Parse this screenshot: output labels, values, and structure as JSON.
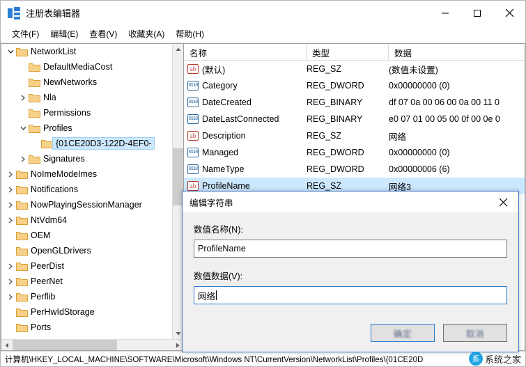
{
  "window": {
    "title": "注册表编辑器",
    "icon": "registry-icon",
    "minimize_label": "—",
    "maximize_label": "□",
    "close_label": "✕"
  },
  "menubar": {
    "items": [
      {
        "label": "文件(F)",
        "name": "menu-file"
      },
      {
        "label": "编辑(E)",
        "name": "menu-edit"
      },
      {
        "label": "查看(V)",
        "name": "menu-view"
      },
      {
        "label": "收藏夹(A)",
        "name": "menu-favorites"
      },
      {
        "label": "帮助(H)",
        "name": "menu-help"
      }
    ]
  },
  "tree": {
    "nodes": [
      {
        "label": "NetworkList",
        "indent": 0,
        "twisty": "expanded",
        "selected": false
      },
      {
        "label": "DefaultMediaCost",
        "indent": 1,
        "twisty": "none",
        "selected": false
      },
      {
        "label": "NewNetworks",
        "indent": 1,
        "twisty": "none",
        "selected": false
      },
      {
        "label": "Nla",
        "indent": 1,
        "twisty": "collapsed",
        "selected": false
      },
      {
        "label": "Permissions",
        "indent": 1,
        "twisty": "none",
        "selected": false
      },
      {
        "label": "Profiles",
        "indent": 1,
        "twisty": "expanded",
        "selected": false
      },
      {
        "label": "{01CE20D3-122D-4EF0-",
        "indent": 2,
        "twisty": "none",
        "selected": true
      },
      {
        "label": "Signatures",
        "indent": 1,
        "twisty": "collapsed",
        "selected": false
      },
      {
        "label": "NoImeModeImes",
        "indent": 0,
        "twisty": "collapsed",
        "selected": false
      },
      {
        "label": "Notifications",
        "indent": 0,
        "twisty": "collapsed",
        "selected": false
      },
      {
        "label": "NowPlayingSessionManager",
        "indent": 0,
        "twisty": "collapsed",
        "selected": false
      },
      {
        "label": "NtVdm64",
        "indent": 0,
        "twisty": "collapsed",
        "selected": false
      },
      {
        "label": "OEM",
        "indent": 0,
        "twisty": "none",
        "selected": false
      },
      {
        "label": "OpenGLDrivers",
        "indent": 0,
        "twisty": "none",
        "selected": false
      },
      {
        "label": "PeerDist",
        "indent": 0,
        "twisty": "collapsed",
        "selected": false
      },
      {
        "label": "PeerNet",
        "indent": 0,
        "twisty": "collapsed",
        "selected": false
      },
      {
        "label": "Perflib",
        "indent": 0,
        "twisty": "collapsed",
        "selected": false
      },
      {
        "label": "PerHwIdStorage",
        "indent": 0,
        "twisty": "none",
        "selected": false
      },
      {
        "label": "Ports",
        "indent": 0,
        "twisty": "none",
        "selected": false
      }
    ]
  },
  "values": {
    "columns": [
      "名称",
      "类型",
      "数据"
    ],
    "rows": [
      {
        "icon": "string-value-icon",
        "name": "(默认)",
        "type": "REG_SZ",
        "data": "(数值未设置)",
        "selected": false
      },
      {
        "icon": "dword-value-icon",
        "name": "Category",
        "type": "REG_DWORD",
        "data": "0x00000000 (0)",
        "selected": false
      },
      {
        "icon": "binary-value-icon",
        "name": "DateCreated",
        "type": "REG_BINARY",
        "data": "df 07 0a 00 06 00 0a 00 11 0",
        "selected": false
      },
      {
        "icon": "binary-value-icon",
        "name": "DateLastConnected",
        "type": "REG_BINARY",
        "data": "e0 07 01 00 05 00 0f 00 0e 0",
        "selected": false
      },
      {
        "icon": "string-value-icon",
        "name": "Description",
        "type": "REG_SZ",
        "data": "网络",
        "selected": false
      },
      {
        "icon": "dword-value-icon",
        "name": "Managed",
        "type": "REG_DWORD",
        "data": "0x00000000 (0)",
        "selected": false
      },
      {
        "icon": "dword-value-icon",
        "name": "NameType",
        "type": "REG_DWORD",
        "data": "0x00000006 (6)",
        "selected": false
      },
      {
        "icon": "string-value-icon",
        "name": "ProfileName",
        "type": "REG_SZ",
        "data": "网络3",
        "selected": true
      }
    ]
  },
  "statusbar": {
    "path": "计算机\\HKEY_LOCAL_MACHINE\\SOFTWARE\\Microsoft\\Windows NT\\CurrentVersion\\NetworkList\\Profiles\\{01CE20D"
  },
  "dialog": {
    "title": "编辑字符串",
    "close_label": "✕",
    "name_label": "数值名称(N):",
    "name_value": "ProfileName",
    "data_label": "数值数据(V):",
    "data_value": "网络",
    "ok_label": "确定",
    "cancel_label": "取消"
  },
  "watermark": {
    "mark": "系",
    "text": "系统之家"
  },
  "colors": {
    "selection": "#cce8ff",
    "accent": "#2a7ad4",
    "string_icon": "#c0392b",
    "dword_icon": "#2e6da4",
    "folder": "#f5c35a"
  }
}
